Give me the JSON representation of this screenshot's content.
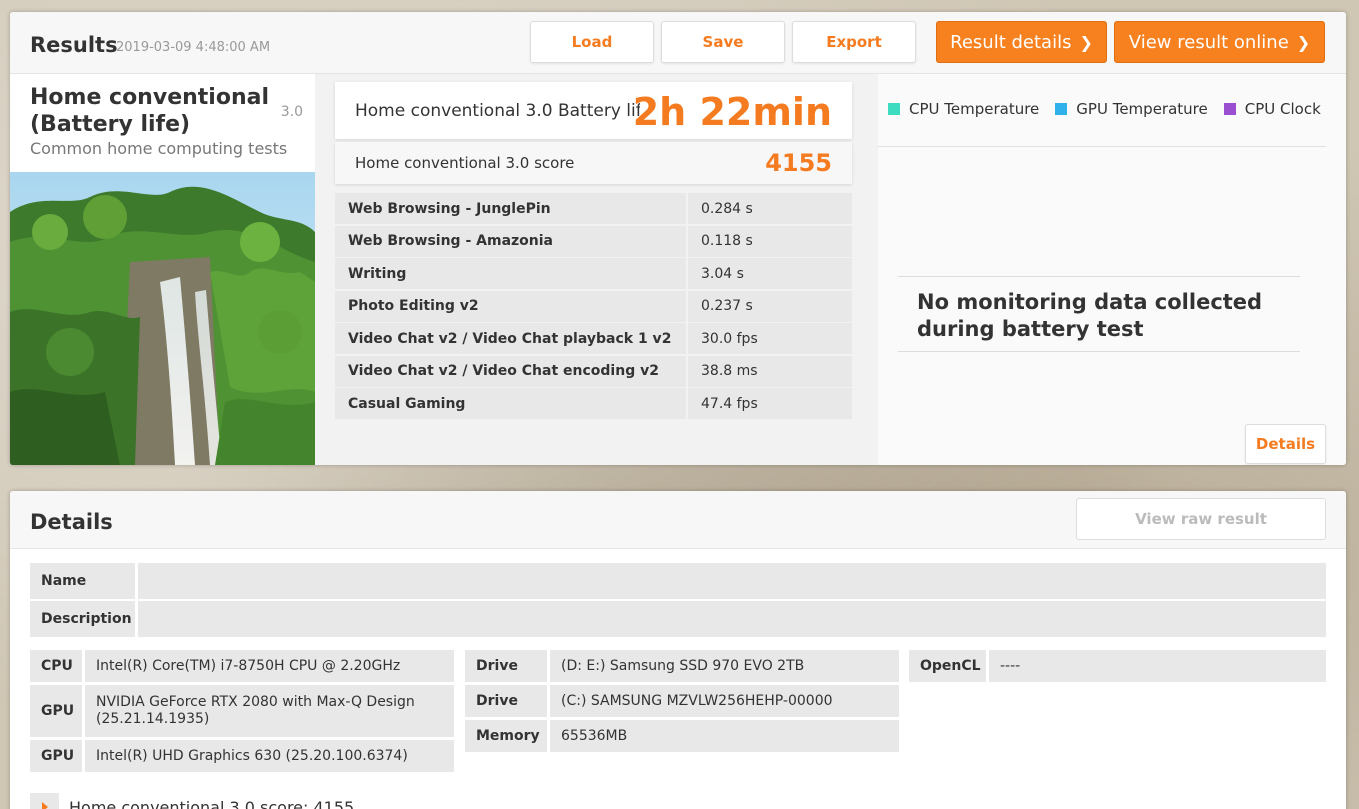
{
  "results": {
    "title": "Results",
    "date": "2019-03-09 4:48:00 AM",
    "buttons": {
      "load": "Load",
      "save": "Save",
      "export": "Export",
      "result_details": "Result details",
      "view_online": "View result online"
    },
    "test": {
      "name": "Home conventional (Battery life)",
      "version": "3.0",
      "description": "Common home computing tests",
      "image": "waterfall-jungle-image"
    },
    "battery": {
      "label": "Home conventional 3.0 Battery life",
      "value": "2h 22min"
    },
    "score": {
      "label": "Home conventional 3.0 score",
      "value": "4155"
    },
    "subtests": [
      {
        "name": "Web Browsing - JunglePin",
        "value": "0.284 s"
      },
      {
        "name": "Web Browsing - Amazonia",
        "value": "0.118 s"
      },
      {
        "name": "Writing",
        "value": "3.04 s"
      },
      {
        "name": "Photo Editing v2",
        "value": "0.237 s"
      },
      {
        "name": "Video Chat v2 / Video Chat playback 1 v2",
        "value": "30.0 fps"
      },
      {
        "name": "Video Chat v2 / Video Chat encoding v2",
        "value": "38.8 ms"
      },
      {
        "name": "Casual Gaming",
        "value": "47.4 fps"
      }
    ],
    "monitoring": {
      "legend": [
        {
          "label": "CPU Temperature",
          "color": "#3ddbc0"
        },
        {
          "label": "GPU Temperature",
          "color": "#2fb1ec"
        },
        {
          "label": "CPU Clock",
          "color": "#9a4fd0"
        }
      ],
      "no_data": "No monitoring data collected during battery test",
      "details_button": "Details"
    }
  },
  "details": {
    "title": "Details",
    "view_raw": "View raw result",
    "name_label": "Name",
    "name_value": "",
    "description_label": "Description",
    "description_value": "",
    "system_col1": [
      {
        "label": "CPU",
        "value": "Intel(R) Core(TM) i7-8750H CPU @ 2.20GHz"
      },
      {
        "label": "GPU",
        "value": "NVIDIA GeForce RTX 2080 with Max-Q Design (25.21.14.1935)"
      },
      {
        "label": "GPU",
        "value": "Intel(R) UHD Graphics 630 (25.20.100.6374)"
      }
    ],
    "system_col2": [
      {
        "label": "Drive",
        "value": "(D: E:) Samsung SSD 970 EVO 2TB"
      },
      {
        "label": "Drive",
        "value": "(C:) SAMSUNG MZVLW256HEHP-00000"
      },
      {
        "label": "Memory",
        "value": "65536MB"
      }
    ],
    "system_col3": [
      {
        "label": "OpenCL",
        "value": "----"
      }
    ],
    "score_footer": "Home conventional 3.0 score: 4155"
  },
  "colors": {
    "accent": "#f47b20",
    "accent_button": "#f7801f"
  }
}
